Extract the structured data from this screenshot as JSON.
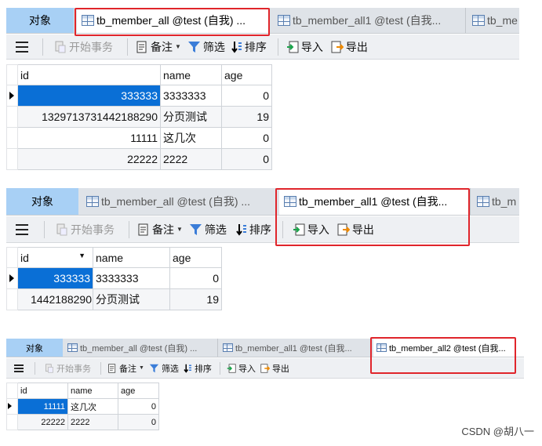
{
  "colors": {
    "highlight": "#e0252b",
    "selected_cell": "#0a6fd6",
    "objects_tab": "#a8d0f5"
  },
  "panel1": {
    "tabs": {
      "objects": "对象",
      "t1": "tb_member_all @test (自我) ...",
      "t2": "tb_member_all1 @test (自我...",
      "t3": "tb_me"
    },
    "toolbar": {
      "begin_tx": "开始事务",
      "note": "备注",
      "filter": "筛选",
      "sort": "排序",
      "import": "导入",
      "export": "导出"
    },
    "columns": [
      "id",
      "name",
      "age"
    ],
    "rows": [
      [
        "333333",
        "3333333",
        "0"
      ],
      [
        "1329713731442188290",
        "分页测试",
        "19"
      ],
      [
        "11111",
        "这几次",
        "0"
      ],
      [
        "22222",
        "2222",
        "0"
      ]
    ]
  },
  "panel2": {
    "tabs": {
      "objects": "对象",
      "t1": "tb_member_all @test (自我) ...",
      "t2": "tb_member_all1 @test (自我...",
      "t3": "tb_m"
    },
    "toolbar": {
      "begin_tx": "开始事务",
      "note": "备注",
      "filter": "筛选",
      "sort": "排序",
      "import": "导入",
      "export": "导出"
    },
    "columns": [
      "id",
      "name",
      "age"
    ],
    "rows": [
      [
        "333333",
        "3333333",
        "0"
      ],
      [
        "1442188290",
        "分页测试",
        "19"
      ]
    ]
  },
  "panel3": {
    "tabs": {
      "objects": "对象",
      "t1": "tb_member_all @test (自我) ...",
      "t2": "tb_member_all1 @test (自我...",
      "t3": "tb_member_all2 @test (自我..."
    },
    "toolbar": {
      "begin_tx": "开始事务",
      "note": "备注",
      "filter": "筛选",
      "sort": "排序",
      "import": "导入",
      "export": "导出"
    },
    "columns": [
      "id",
      "name",
      "age"
    ],
    "rows": [
      [
        "11111",
        "这几次",
        "0"
      ],
      [
        "22222",
        "2222",
        "0"
      ]
    ]
  },
  "watermark": "CSDN @胡八一"
}
